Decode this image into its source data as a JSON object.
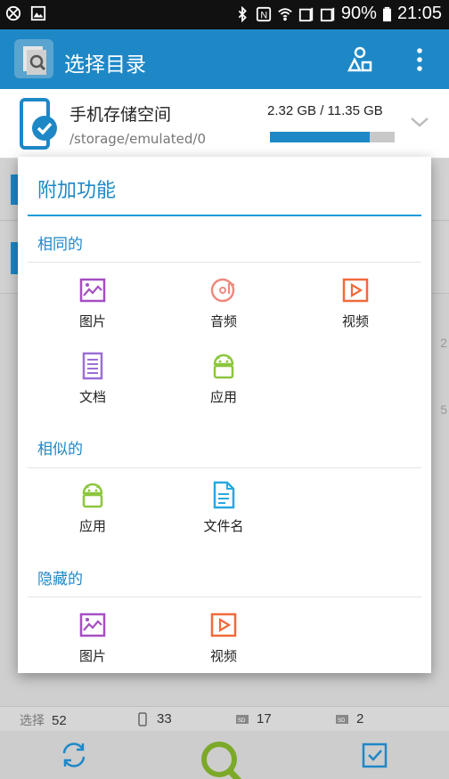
{
  "status_bar": {
    "battery": "90%",
    "time": "21:05",
    "icons": [
      "no-disturb-icon",
      "image-notification-icon",
      "bluetooth-icon",
      "nfc-icon",
      "wifi-icon",
      "sim1-signal-icon",
      "sim2-signal-icon",
      "battery-icon"
    ]
  },
  "app_bar": {
    "title": "选择目录",
    "actions": [
      "storage-switch-icon",
      "more-vert-icon"
    ]
  },
  "storage": {
    "name": "手机存储空间",
    "path": "/storage/emulated/0",
    "size": "2.32 GB / 11.35 GB",
    "used_fraction": 0.8
  },
  "background_list": {
    "numbers": [
      "2",
      "5"
    ]
  },
  "counts": {
    "select_label": "选择",
    "select_count": "52",
    "phone_count": "33",
    "sd1_count": "17",
    "sd2_count": "2"
  },
  "bottom_nav": {
    "items": [
      "refresh-icon",
      "search-icon",
      "select-all-icon"
    ]
  },
  "dialog": {
    "title": "附加功能",
    "sections": [
      {
        "title": "相同的",
        "items": [
          {
            "label": "图片",
            "icon": "picture-icon",
            "color": "#a64ec4"
          },
          {
            "label": "音频",
            "icon": "audio-icon",
            "color": "#ee8a7e"
          },
          {
            "label": "视频",
            "icon": "video-icon",
            "color": "#f06a3a"
          },
          {
            "label": "文档",
            "icon": "document-icon",
            "color": "#9b6fd6"
          },
          {
            "label": "应用",
            "icon": "android-icon",
            "color": "#8cc63e"
          }
        ]
      },
      {
        "title": "相似的",
        "items": [
          {
            "label": "应用",
            "icon": "android-icon",
            "color": "#8cc63e"
          },
          {
            "label": "文件名",
            "icon": "file-name-icon",
            "color": "#29a8e0"
          }
        ]
      },
      {
        "title": "隐藏的",
        "items": [
          {
            "label": "图片",
            "icon": "picture-icon",
            "color": "#a64ec4"
          },
          {
            "label": "视频",
            "icon": "video-icon",
            "color": "#f06a3a"
          }
        ]
      }
    ]
  },
  "colors": {
    "primary": "#1e88c7",
    "status_bar": "#111111",
    "dialog_accent": "#1e9bd8"
  }
}
